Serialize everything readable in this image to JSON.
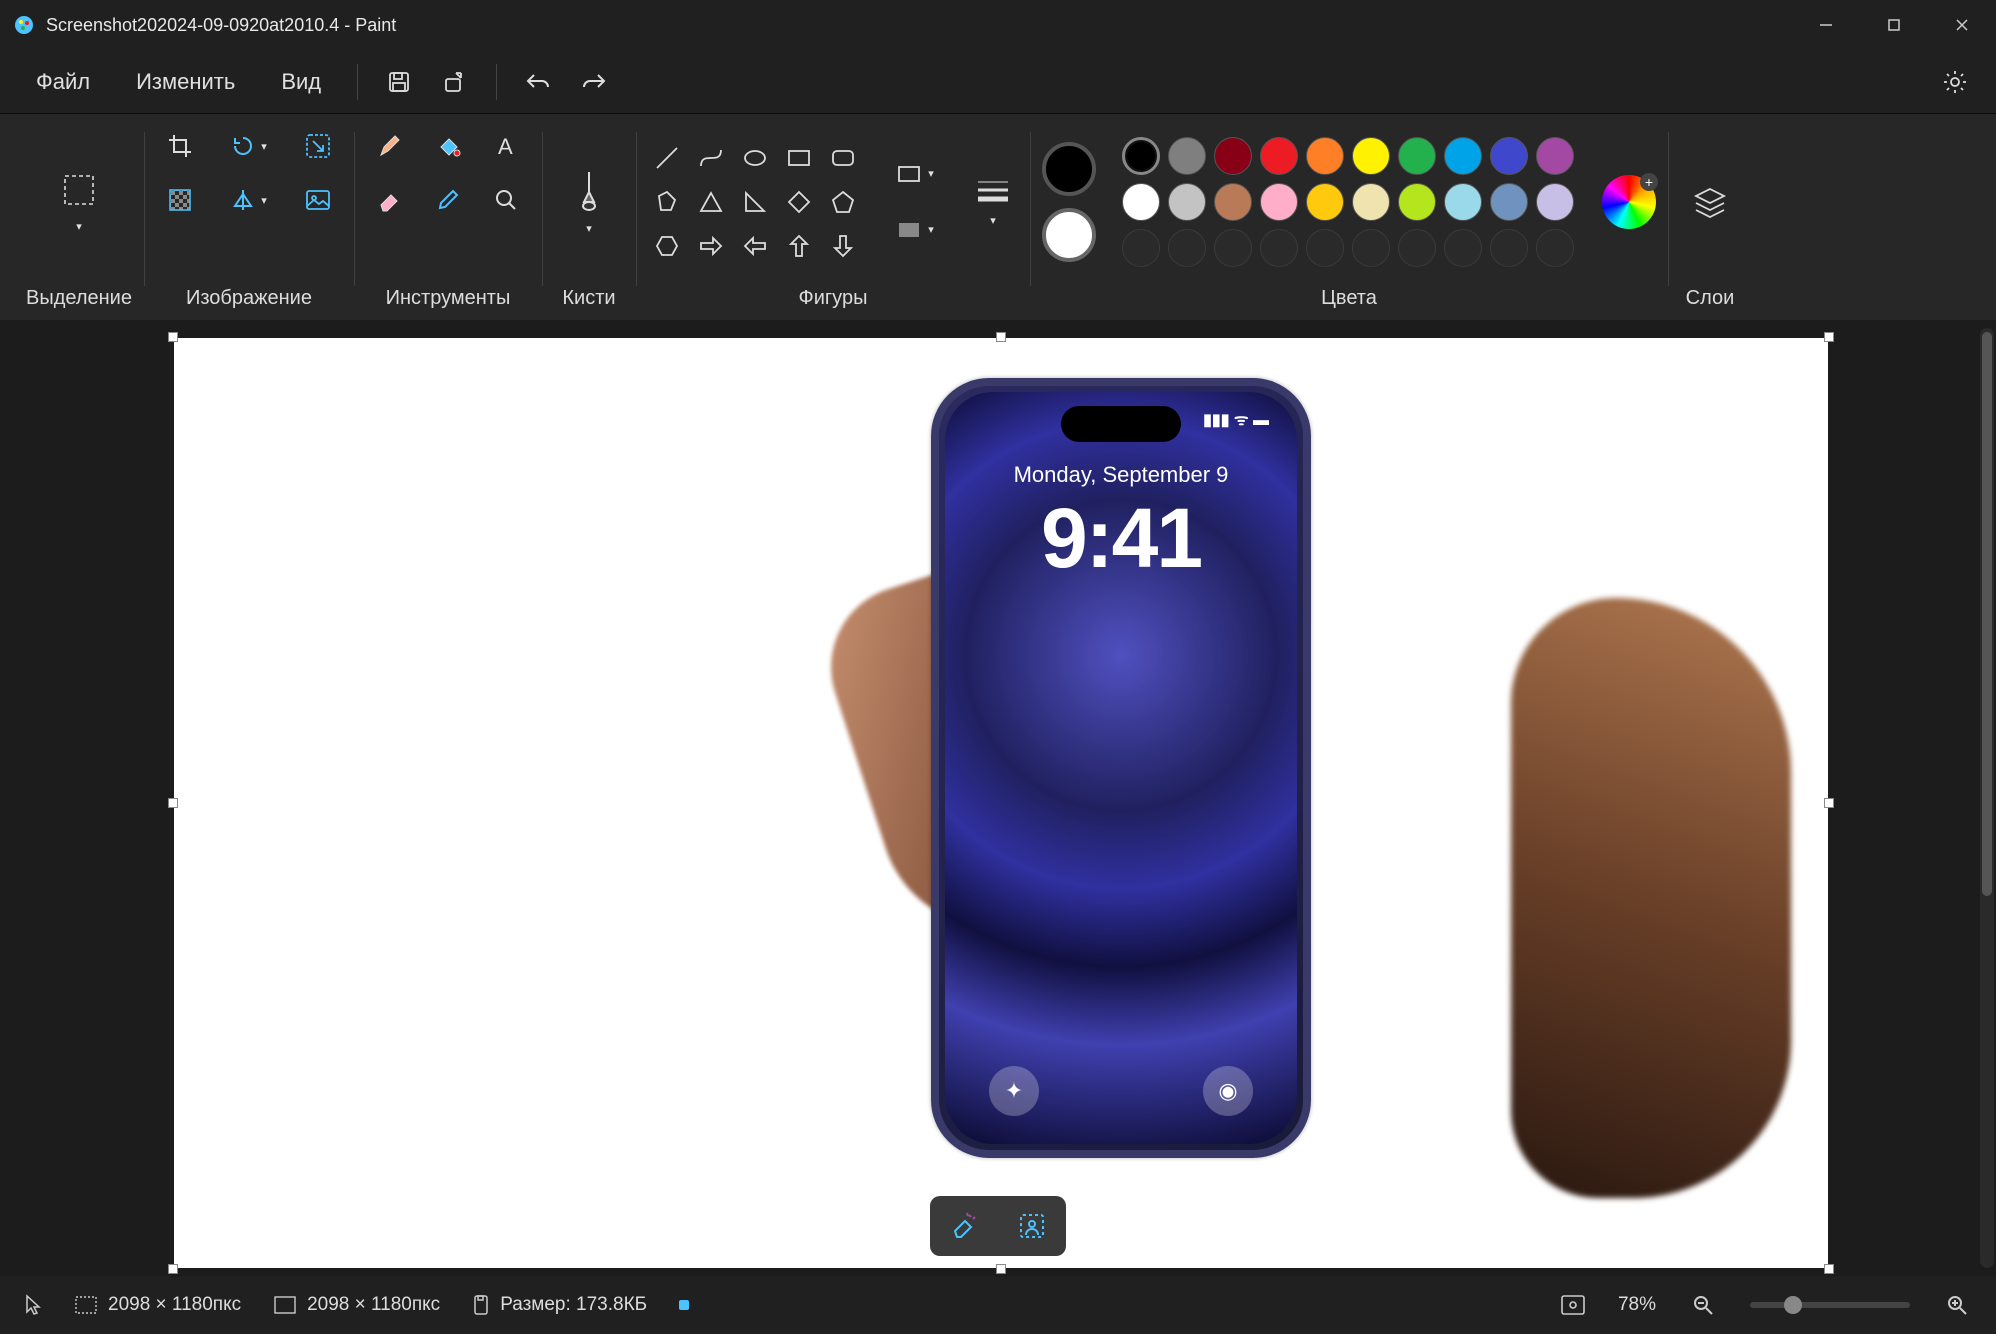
{
  "titlebar": {
    "title": "Screenshot202024-09-0920at2010.4 - Paint"
  },
  "menu": {
    "file": "Файл",
    "edit": "Изменить",
    "view": "Вид"
  },
  "ribbon": {
    "selection": "Выделение",
    "image": "Изображение",
    "tools": "Инструменты",
    "brushes": "Кисти",
    "shapes": "Фигуры",
    "colors": "Цвета",
    "layers": "Слои"
  },
  "palette": {
    "primary": "#000000",
    "secondary": "#ffffff",
    "row1": [
      "#000000",
      "#7f7f7f",
      "#880015",
      "#ed1c24",
      "#ff7f27",
      "#fff200",
      "#22b14c",
      "#00a2e8",
      "#3f48cc",
      "#a349a4"
    ],
    "row2": [
      "#ffffff",
      "#c3c3c3",
      "#b97a57",
      "#ffaec9",
      "#ffc90e",
      "#efe4b0",
      "#b5e61d",
      "#99d9ea",
      "#7092be",
      "#c8bfe7"
    ],
    "row3_empty": 10
  },
  "canvas_content": {
    "phone_date": "Monday, September 9",
    "phone_time": "9:41",
    "status_icons": "▮▮▮  ᯤ  ▬"
  },
  "statusbar": {
    "cursor_dims": "2098 × 1180пкс",
    "canvas_dims": "2098 × 1180пкс",
    "size_label": "Размер: 173.8КБ",
    "zoom": "78%"
  }
}
